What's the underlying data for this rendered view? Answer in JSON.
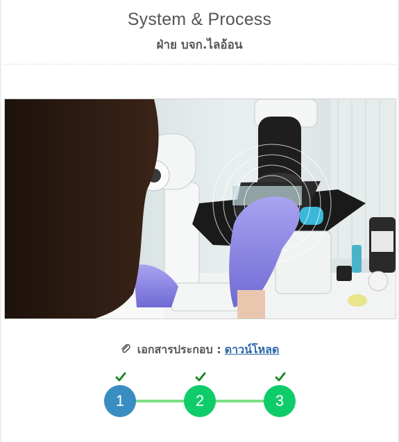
{
  "header": {
    "title": "System & Process",
    "subtitle": "ฝ่าย บจก.ไลอ้อน"
  },
  "hero_image": {
    "alt": "",
    "description_icon": "microscope-lab-photo"
  },
  "attachment": {
    "icon": "paperclip-icon",
    "label": "เอกสารประกอบ :",
    "link_text": "ดาวน์โหลด"
  },
  "steps": [
    {
      "number": "1",
      "status": "current",
      "color": "#3a8dc1",
      "check": true
    },
    {
      "number": "2",
      "status": "done",
      "color": "#0fcc6a",
      "check": true
    },
    {
      "number": "3",
      "status": "done",
      "color": "#0fcc6a",
      "check": true
    }
  ],
  "colors": {
    "link": "#2a67a8",
    "connector": "#7ddf86",
    "check": "#1a8a1a"
  }
}
